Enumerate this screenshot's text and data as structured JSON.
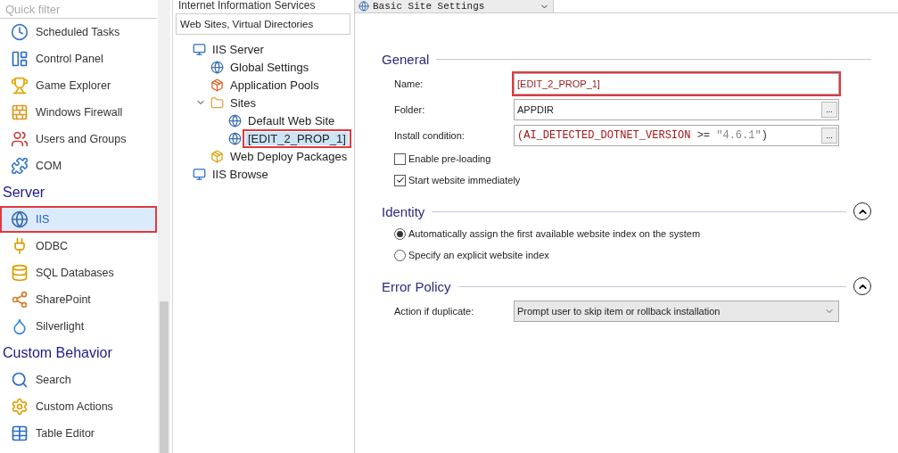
{
  "sidebar": {
    "filter": {
      "placeholder": "Quick filter"
    },
    "items": [
      {
        "kind": "item",
        "label": "Scheduled Tasks",
        "selected": false,
        "highlighted": false
      },
      {
        "kind": "item",
        "label": "Control Panel",
        "selected": false,
        "highlighted": false
      },
      {
        "kind": "item",
        "label": "Game Explorer",
        "selected": false,
        "highlighted": false
      },
      {
        "kind": "item",
        "label": "Windows Firewall",
        "selected": false,
        "highlighted": false
      },
      {
        "kind": "item",
        "label": "Users and Groups",
        "selected": false,
        "highlighted": false
      },
      {
        "kind": "item",
        "label": "COM",
        "selected": false,
        "highlighted": false
      },
      {
        "kind": "header",
        "label": "Server"
      },
      {
        "kind": "item",
        "label": "IIS",
        "selected": true,
        "highlighted": true
      },
      {
        "kind": "item",
        "label": "ODBC",
        "selected": false,
        "highlighted": false
      },
      {
        "kind": "item",
        "label": "SQL Databases",
        "selected": false,
        "highlighted": false
      },
      {
        "kind": "item",
        "label": "SharePoint",
        "selected": false,
        "highlighted": false
      },
      {
        "kind": "item",
        "label": "Silverlight",
        "selected": false,
        "highlighted": false
      },
      {
        "kind": "header",
        "label": "Custom Behavior"
      },
      {
        "kind": "item",
        "label": "Search",
        "selected": false,
        "highlighted": false
      },
      {
        "kind": "item",
        "label": "Custom Actions",
        "selected": false,
        "highlighted": false
      },
      {
        "kind": "item",
        "label": "Table Editor",
        "selected": false,
        "highlighted": false
      }
    ]
  },
  "tree_pane": {
    "title": "Internet Information Services",
    "header": "Web Sites, Virtual Directories",
    "tree": [
      {
        "label": "IIS Server",
        "selected": false,
        "highlighted": false,
        "children": [
          {
            "label": "Global Settings",
            "selected": false,
            "highlighted": false
          },
          {
            "label": "Application Pools",
            "selected": false,
            "highlighted": false
          },
          {
            "label": "Sites",
            "expanded": true,
            "selected": false,
            "highlighted": false,
            "children": [
              {
                "label": "Default Web Site",
                "selected": false,
                "highlighted": false
              },
              {
                "label": "[EDIT_2_PROP_1]",
                "selected": true,
                "highlighted": true
              }
            ]
          },
          {
            "label": "Web Deploy Packages",
            "selected": false,
            "highlighted": false
          }
        ]
      },
      {
        "label": "IIS Browse",
        "selected": false,
        "highlighted": false
      }
    ]
  },
  "editor": {
    "tab": {
      "label": "Basic Site Settings"
    },
    "sections": [
      {
        "title": "General",
        "collapsible": false,
        "rows": [
          {
            "kind": "text",
            "label": "Name:",
            "value": "[EDIT_2_PROP_1]",
            "highlighted": true,
            "browse": false
          },
          {
            "kind": "text",
            "label": "Folder:",
            "value": "APPDIR",
            "highlighted": false,
            "browse": true,
            "browse_label": "..."
          },
          {
            "kind": "expression",
            "label": "Install condition:",
            "browse": true,
            "browse_label": "...",
            "tokens": [
              {
                "kind": "name",
                "text": "(AI_DETECTED_DOTNET_VERSION"
              },
              {
                "kind": "op",
                "text": " >= "
              },
              {
                "kind": "string",
                "text": "\"4.6.1\""
              },
              {
                "kind": "op",
                "text": ")"
              }
            ]
          },
          {
            "kind": "checkbox",
            "label": "Enable pre-loading",
            "checked": false
          },
          {
            "kind": "checkbox",
            "label": "Start website immediately",
            "checked": true
          }
        ]
      },
      {
        "title": "Identity",
        "collapsible": true,
        "rows": [
          {
            "kind": "radio",
            "label": "Automatically assign the first available website index on the system",
            "selected": true
          },
          {
            "kind": "radio",
            "label": "Specify an explicit website index",
            "selected": false
          }
        ]
      },
      {
        "title": "Error Policy",
        "collapsible": true,
        "rows": [
          {
            "kind": "select",
            "label": "Action if duplicate:",
            "value": "Prompt user to skip item or rollback installation"
          }
        ]
      }
    ]
  }
}
